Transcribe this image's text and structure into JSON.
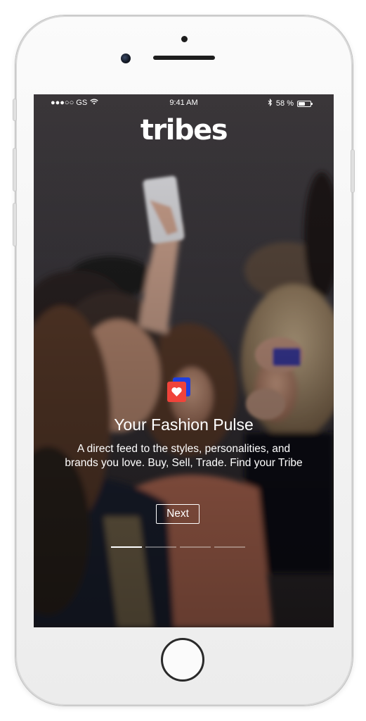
{
  "status_bar": {
    "carrier": "●●●○○ GS",
    "time": "9:41 AM",
    "battery_percent": "58 %",
    "battery_level": 0.58,
    "icons": [
      "wifi-icon",
      "bluetooth-icon",
      "battery-icon"
    ]
  },
  "app": {
    "logo_text": "tribes"
  },
  "onboarding": {
    "icon": "heart-badge-icon",
    "headline": "Your Fashion Pulse",
    "description": "A direct feed to the styles, personalities, and brands you love. Buy, Sell, Trade. Find your Tribe",
    "next_label": "Next",
    "page_count": 4,
    "current_page": 1
  },
  "colors": {
    "accent_red": "#f0433a",
    "accent_blue": "#1f3fe0",
    "overlay_text": "#ffffff"
  }
}
